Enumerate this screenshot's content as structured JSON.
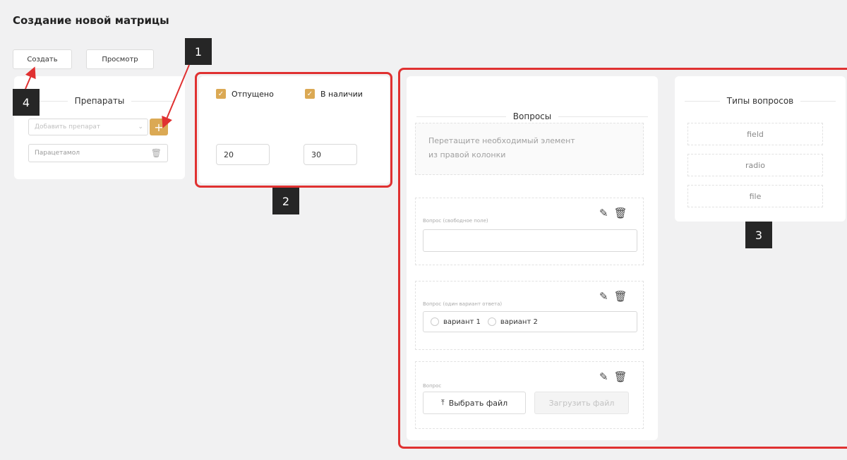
{
  "page_title": "Создание новой матрицы",
  "toolbar": {
    "create_label": "Создать",
    "preview_label": "Просмотр"
  },
  "drugs": {
    "title": "Препараты",
    "add_placeholder": "Добавить препарат",
    "add_button": "+",
    "items": [
      "Парацетамол"
    ]
  },
  "filters": {
    "dispensed_label": "Отпущено",
    "in_stock_label": "В наличии",
    "dispensed_value": "20",
    "in_stock_value": "30"
  },
  "questions": {
    "title": "Вопросы",
    "drop_hint_line1": "Перетащите необходимый элемент",
    "drop_hint_line2": "из правой колонки",
    "items": [
      {
        "label": "Вопрос (свободное поле)"
      },
      {
        "label": "Вопрос (один вариант ответа)",
        "option1": "вариант 1",
        "option2": "вариант 2"
      },
      {
        "label": "Вопрос",
        "choose_file": "Выбрать файл",
        "upload_file": "Загрузить файл"
      }
    ]
  },
  "question_types": {
    "title": "Типы вопросов",
    "items": [
      "field",
      "radio",
      "file"
    ]
  },
  "annotations": {
    "tag1": "1",
    "tag2": "2",
    "tag3": "3",
    "tag4": "4"
  },
  "colors": {
    "accent": "#dba954",
    "highlight": "#e03131",
    "tag_bg": "#262626"
  }
}
